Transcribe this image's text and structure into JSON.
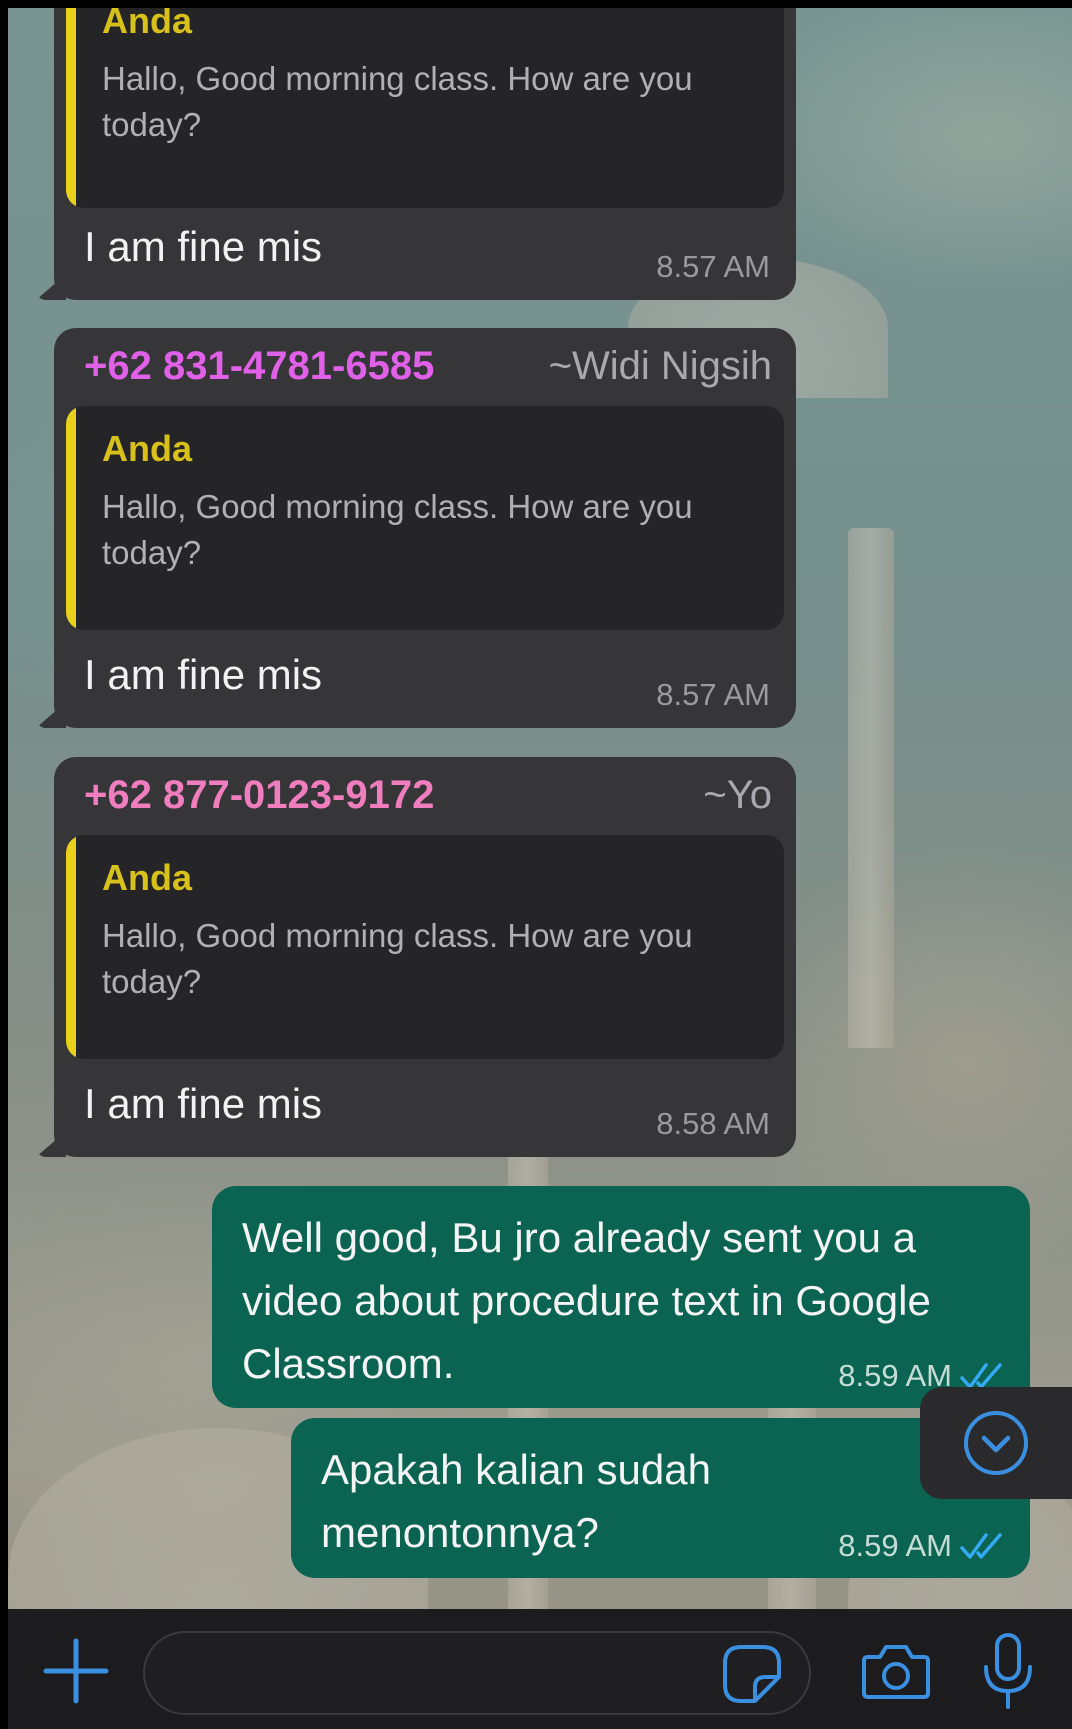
{
  "colors": {
    "in_bubble": "#363638",
    "quote_bg": "#252527",
    "quote_bar": "#e9d01a",
    "quote_author": "#d9c11c",
    "out_bubble": "#0b6352",
    "read_tick": "#34aaf2",
    "accent_blue": "#3a8fe0",
    "sender_magenta": "#e060e8",
    "sender_pink": "#f07dbd"
  },
  "messages": [
    {
      "quote": {
        "author": "Anda",
        "text": "Hallo, Good morning class. How are you today?"
      },
      "text": "I am fine mis",
      "time": "8.57 AM"
    },
    {
      "sender": "+62 831-4781-6585",
      "alias": "~Widi Nigsih",
      "sender_color": "#e060e8",
      "quote": {
        "author": "Anda",
        "text": "Hallo, Good morning class. How are you today?"
      },
      "text": "I am fine mis",
      "time": "8.57 AM"
    },
    {
      "sender": "+62 877-0123-9172",
      "alias": "~Yo",
      "sender_color": "#f07dbd",
      "quote": {
        "author": "Anda",
        "text": "Hallo, Good morning class. How are you today?"
      },
      "text": "I am fine mis",
      "time": "8.58 AM"
    }
  ],
  "outgoing": [
    {
      "text": "Well good, Bu jro already sent you a video about procedure text in Google Classroom.",
      "time": "8.59 AM",
      "status": "read"
    },
    {
      "text": "Apakah kalian sudah menontonnya?",
      "time": "8.59 AM",
      "status": "read"
    }
  ],
  "composer": {
    "value": "",
    "placeholder": "",
    "icons": [
      "plus-icon",
      "sticker-icon",
      "camera-icon",
      "microphone-icon"
    ]
  },
  "scroll_button": {
    "icon": "chevron-down-circle-icon"
  }
}
